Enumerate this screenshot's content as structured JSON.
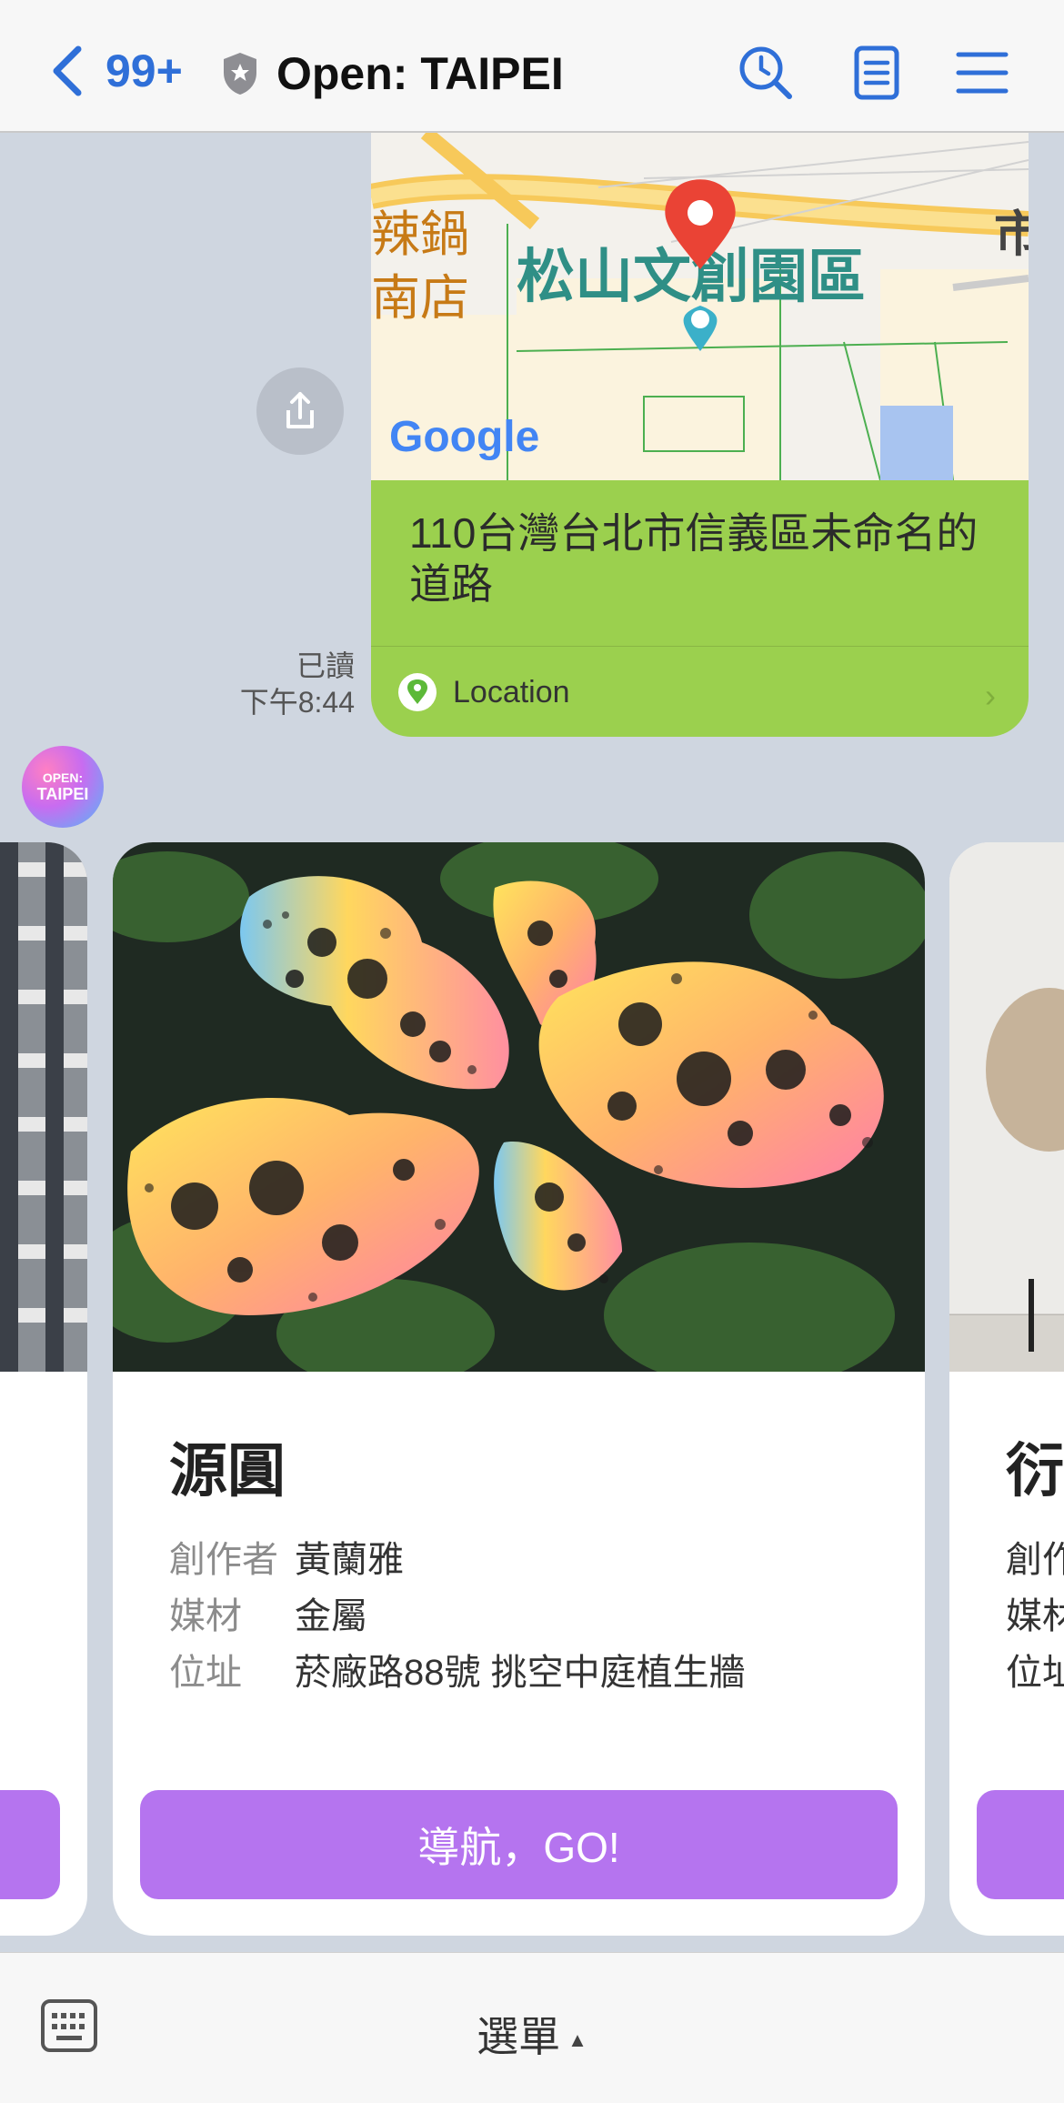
{
  "header": {
    "back_count": "99+",
    "title": "Open: TAIPEI",
    "icons": [
      "back-chevron-icon",
      "shield-icon",
      "search-history-icon",
      "notes-icon",
      "menu-icon"
    ],
    "accent_color": "#2f6fd8"
  },
  "map_message": {
    "map_labels": {
      "park": "松山文創園區",
      "shop_line1": "辣鍋",
      "shop_line2": "南店",
      "edge": "市",
      "brand": "Google"
    },
    "address": "110台灣台北市信義區未命名的道路",
    "location_label": "Location",
    "read_status": "已讀",
    "time": "下午8:44",
    "bubble_color": "#9bd04e"
  },
  "avatar": {
    "line1": "OPEN:",
    "line2": "TAIPEI"
  },
  "cards": {
    "main": {
      "title": "源圓",
      "creator_label": "創作者",
      "creator": "黃蘭雅",
      "medium_label": "媒材",
      "medium": "金屬",
      "location_label": "位址",
      "location": "菸廠路88號 挑空中庭植生牆",
      "button": "導航，GO!"
    },
    "right": {
      "title": "衍",
      "creator_label": "創作",
      "medium_label": "媒材",
      "location_label": "位址"
    },
    "button_color": "#b574ef"
  },
  "footer": {
    "menu_label": "選單",
    "menu_arrow": "▲"
  }
}
